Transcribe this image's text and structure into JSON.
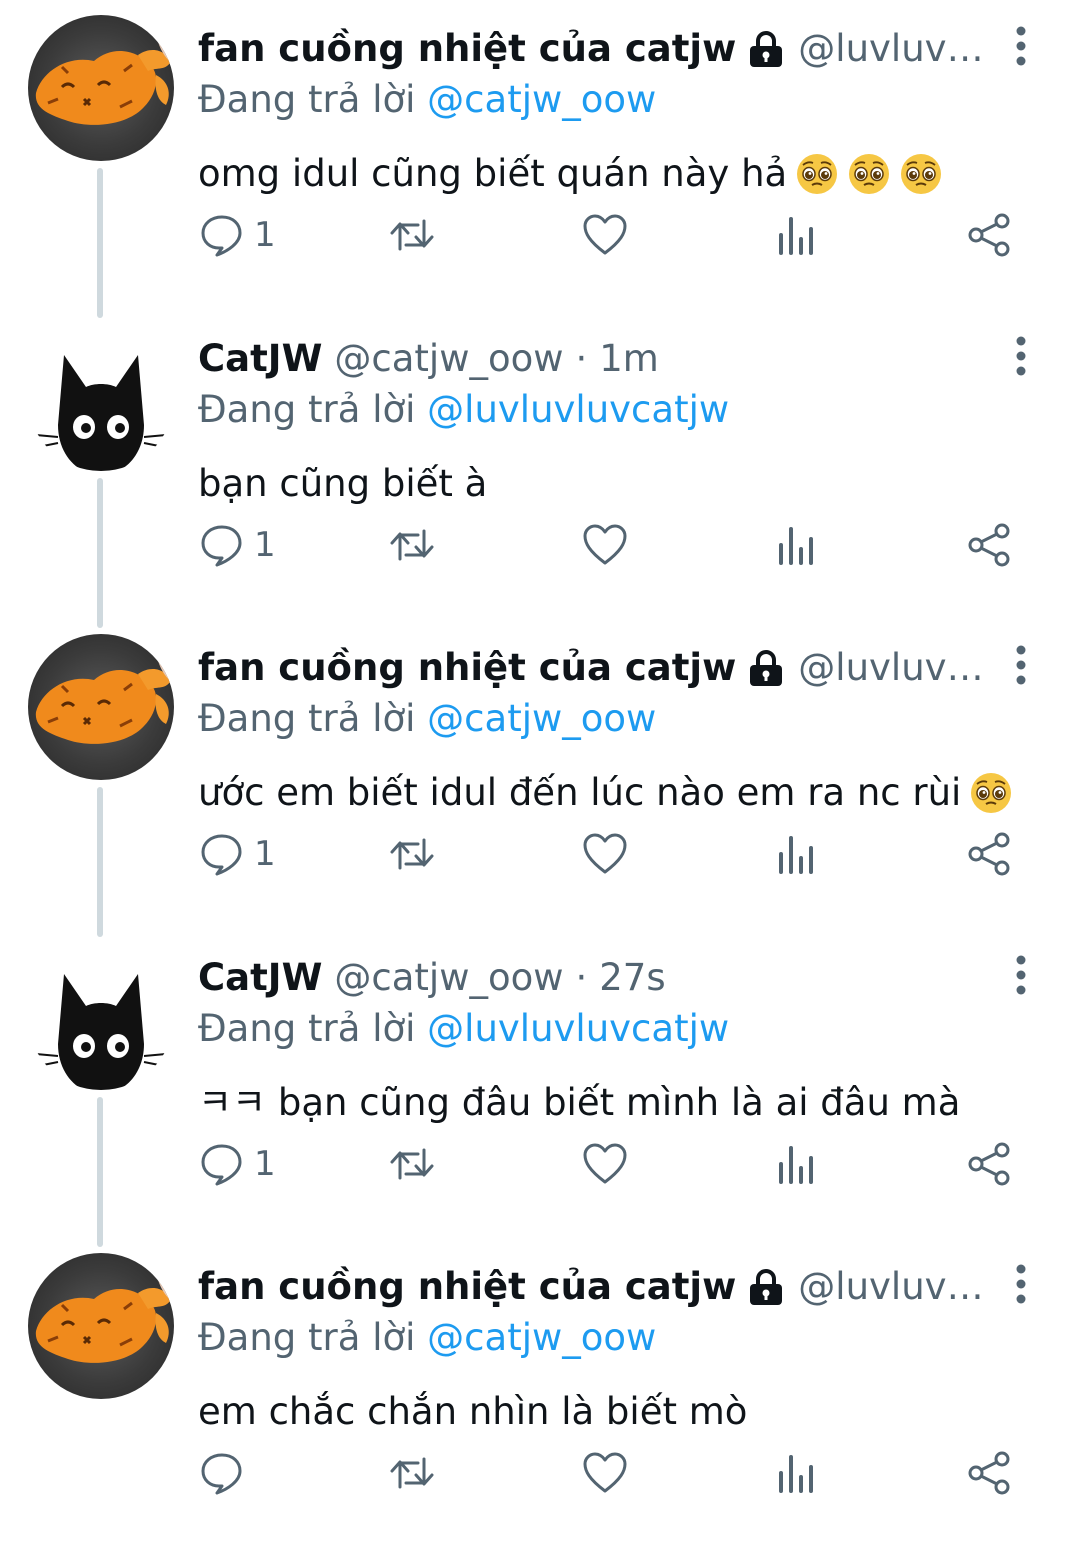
{
  "replying_prefix": "Đang trả lời",
  "tweets": [
    {
      "author": "fan cuồng nhiệt của catjw",
      "handle": "@luvluvluvc...",
      "locked": true,
      "time": "",
      "reply_to": "@catjw_oow",
      "text": "omg idul cũng biết quán này hả",
      "emoji_count": 3,
      "reply_count": "1",
      "avatar": "orange-peel-avatar"
    },
    {
      "author": "CatJW",
      "handle": "@catjw_oow",
      "locked": false,
      "time": "1m",
      "reply_to": "@luvluvluvcatjw",
      "text": "bạn cũng biết à",
      "emoji_count": 0,
      "reply_count": "1",
      "avatar": "black-cat-avatar"
    },
    {
      "author": "fan cuồng nhiệt của catjw",
      "handle": "@luvluvluvc...",
      "locked": true,
      "time": "",
      "reply_to": "@catjw_oow",
      "text": "ước em biết idul đến lúc nào em ra nc rùi",
      "emoji_count": 1,
      "reply_count": "1",
      "avatar": "orange-peel-avatar"
    },
    {
      "author": "CatJW",
      "handle": "@catjw_oow",
      "locked": false,
      "time": "27s",
      "reply_to": "@luvluvluvcatjw",
      "text": "ㅋㅋ bạn cũng đâu biết mình là ai đâu mà",
      "emoji_count": 0,
      "reply_count": "1",
      "avatar": "black-cat-avatar"
    },
    {
      "author": "fan cuồng nhiệt của catjw",
      "handle": "@luvluvluvc...",
      "locked": true,
      "time": "",
      "reply_to": "@catjw_oow",
      "text": "em chắc chắn nhìn là biết mò",
      "emoji_count": 0,
      "reply_count": "",
      "avatar": "orange-peel-avatar"
    }
  ],
  "time_separator": "·",
  "colors": {
    "text": "#0f1419",
    "secondary": "#536471",
    "link": "#1d9bf0",
    "thread_line": "#cfd9de",
    "icon": "#536471"
  }
}
